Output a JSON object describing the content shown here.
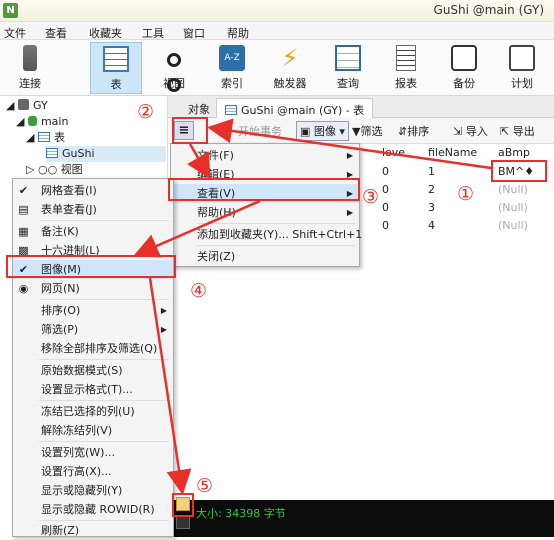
{
  "app": {
    "title": "GuShi @main (GY)",
    "icon": "navicat-icon"
  },
  "menubar": [
    "文件",
    "查看",
    "收藏夹",
    "工具",
    "窗口",
    "帮助"
  ],
  "toolbar": [
    {
      "label": "连接",
      "icon": "connection-icon"
    },
    {
      "label": "表",
      "icon": "table-icon",
      "active": true
    },
    {
      "label": "视图",
      "icon": "view-icon"
    },
    {
      "label": "索引",
      "icon": "index-icon"
    },
    {
      "label": "触发器",
      "icon": "trigger-icon"
    },
    {
      "label": "查询",
      "icon": "query-icon"
    },
    {
      "label": "报表",
      "icon": "report-icon"
    },
    {
      "label": "备份",
      "icon": "backup-icon"
    },
    {
      "label": "计划",
      "icon": "schedule-icon"
    }
  ],
  "tree": {
    "server": "GY",
    "database": "main",
    "tables_node": "表",
    "table": "GuShi",
    "views_node": "视图"
  },
  "tabs": {
    "objects": "对象",
    "table_tab": "GuShi @main (GY) - 表"
  },
  "subtoolbar": {
    "begin_tx": "开始事务",
    "image": "图像",
    "filter": "筛选",
    "sort": "排序",
    "import": "导入",
    "export": "导出"
  },
  "grid": {
    "columns": [
      "love",
      "fileName",
      "aBmp"
    ],
    "rows": [
      [
        "0",
        "1",
        "BM^♦"
      ],
      [
        "0",
        "2",
        "(Null)"
      ],
      [
        "0",
        "3",
        "(Null)"
      ],
      [
        "0",
        "4",
        "(Null)"
      ]
    ]
  },
  "status": {
    "text": "大小: 34398 字节"
  },
  "hamburger_menu": [
    {
      "label": "文件(F)",
      "submenu": true
    },
    {
      "label": "编辑(E)",
      "submenu": true
    },
    {
      "label": "查看(V)",
      "submenu": true,
      "highlighted": true
    },
    {
      "label": "帮助(H)",
      "submenu": true
    },
    {
      "label": "添加到收藏夹(Y)...  Shift+Ctrl+1"
    },
    {
      "label": "关闭(Z)"
    }
  ],
  "view_submenu": [
    {
      "label": "网格查看(I)",
      "icon": "check-icon"
    },
    {
      "label": "表单查看(J)",
      "icon": "form-icon"
    },
    {
      "label": "备注(K)",
      "icon": "note-icon"
    },
    {
      "label": "十六进制(L)",
      "icon": "hex-icon"
    },
    {
      "label": "图像(M)",
      "icon": "check-icon",
      "highlighted": true
    },
    {
      "label": "网页(N)",
      "icon": "web-icon"
    },
    {
      "label": "排序(O)",
      "submenu": true
    },
    {
      "label": "筛选(P)",
      "submenu": true
    },
    {
      "label": "移除全部排序及筛选(Q)"
    },
    {
      "label": "原始数据模式(S)"
    },
    {
      "label": "设置显示格式(T)..."
    },
    {
      "label": "冻结已选择的列(U)"
    },
    {
      "label": "解除冻结列(V)"
    },
    {
      "label": "设置列宽(W)..."
    },
    {
      "label": "设置行高(X)..."
    },
    {
      "label": "显示或隐藏列(Y)"
    },
    {
      "label": "显示或隐藏 ROWID(R)"
    },
    {
      "label": "刷新(Z)"
    }
  ],
  "annotations": [
    "①",
    "②",
    "③",
    "④",
    "⑤"
  ],
  "colors": {
    "highlight": "#e8302a",
    "menu_hl": "#cfe5fa",
    "status_bg": "#0c0c0c",
    "status_fg": "#37c837"
  }
}
